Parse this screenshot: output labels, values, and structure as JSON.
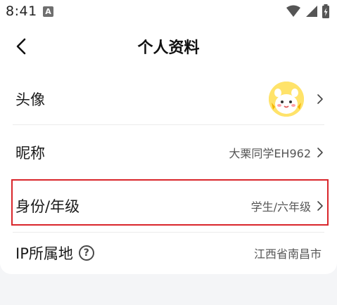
{
  "status_bar": {
    "time": "8:41",
    "badge_letter": "A",
    "icons": [
      "wifi-icon",
      "signal-icon",
      "battery-icon"
    ]
  },
  "header": {
    "title": "个人资料",
    "back_icon": "chevron-left-icon"
  },
  "rows": [
    {
      "label": "头像",
      "value": "",
      "has_chevron": true
    },
    {
      "label": "昵称",
      "value": "大栗同学EH962",
      "has_chevron": true
    },
    {
      "label": "身份/年级",
      "value": "学生/六年级",
      "has_chevron": true
    },
    {
      "label": "IP所属地",
      "value": "江西省南昌市",
      "has_chevron": false
    }
  ],
  "colors": {
    "highlight_border": "#d9262b",
    "background": "#f4f5f7",
    "card": "#ffffff"
  }
}
